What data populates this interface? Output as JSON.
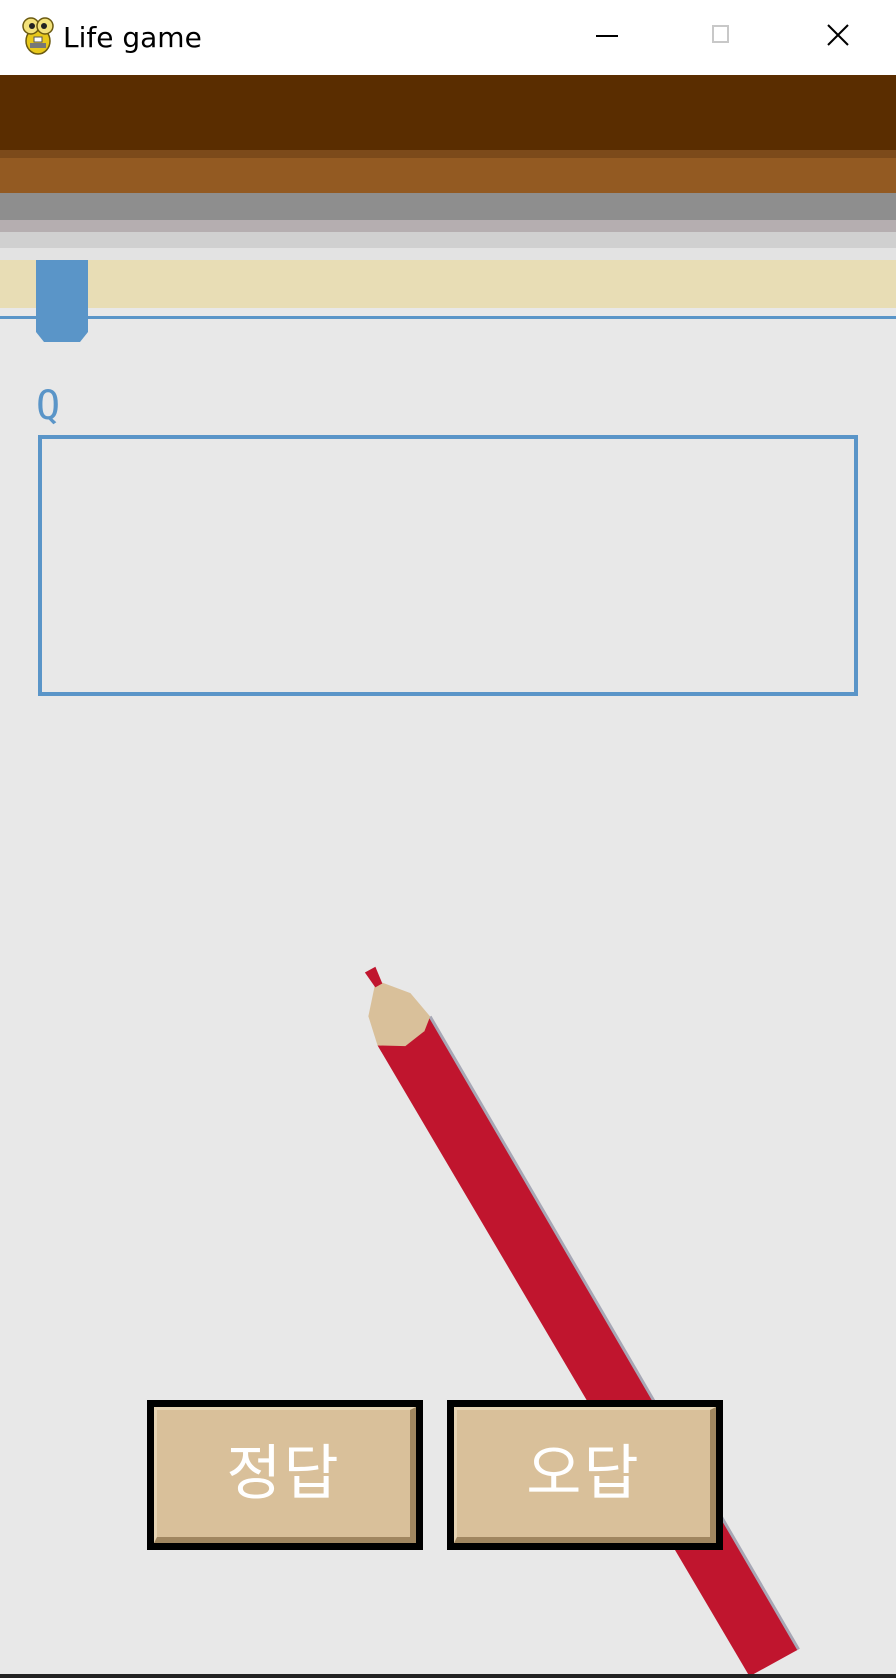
{
  "window": {
    "title": "Life game",
    "icon": "snake-game-icon",
    "controls": [
      "minimize-icon",
      "maximize-icon",
      "close-icon"
    ]
  },
  "question": {
    "label": "Q",
    "text": ""
  },
  "buttons": {
    "correct_label": "정답",
    "wrong_label": "오답"
  },
  "colors": {
    "accent_blue": "#5a95c8",
    "dark_brown": "#5a2d00",
    "light_brown": "#935a22",
    "cream": "#e8ddb5",
    "button_tan": "#d9c09a",
    "pencil_red": "#c0152e",
    "pencil_wood": "#d9c09a",
    "background": "#e8e8e8"
  }
}
